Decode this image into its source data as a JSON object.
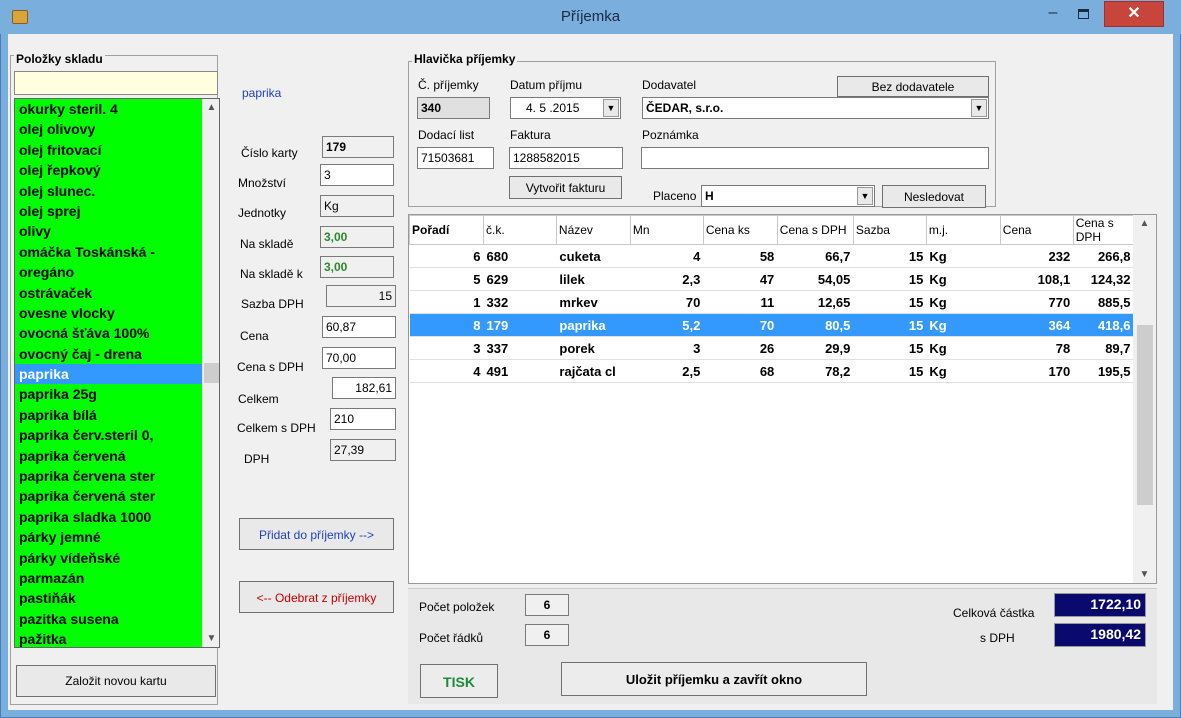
{
  "window": {
    "title": "Příjemka",
    "min": "–",
    "close": "✕"
  },
  "left": {
    "title": "Položky skladu",
    "search_value": "",
    "items": [
      "okurky steril. 4",
      "olej  olivovy",
      "olej fritovací",
      "olej řepkový",
      "olej slunec.",
      "olej sprej",
      "olivy",
      "omáčka Toskánská -",
      "oregáno",
      "ostrávaček",
      "ovesne vlocky",
      "ovocná šťáva 100%",
      "ovocný čaj - drena",
      "paprika",
      "paprika 25g",
      "paprika bílá",
      "paprika červ.steril 0,",
      "paprika červená",
      "paprika červena ster",
      "paprika červená ster",
      "paprika sladka 1000",
      "párky jemné",
      "párky vídeňské",
      "parmazán",
      "pastiňák",
      "pazitka susena",
      "pažitka"
    ],
    "selected_index": 13,
    "new_card_label": "Založit novou kartu"
  },
  "detail": {
    "name": "paprika",
    "labels": {
      "card_no": "Číslo karty",
      "qty": "Množství",
      "unit": "Jednotky",
      "stock": "Na skladě",
      "stock_k": "Na skladě k",
      "vat_rate": "Sazba DPH",
      "price": "Cena",
      "price_vat": "Cena s DPH",
      "total": "Celkem",
      "total_vat": "Celkem s DPH",
      "vat": "DPH"
    },
    "values": {
      "card_no": "179",
      "qty": "3",
      "unit": "Kg",
      "stock": "3,00",
      "stock_k": "3,00",
      "vat_rate": "15",
      "price": "60,87",
      "price_vat": "70,00",
      "total": "182,61",
      "total_vat": "210",
      "vat": "27,39"
    },
    "add_label": "Přidat do příjemky -->",
    "remove_label": "<-- Odebrat z příjemky"
  },
  "header": {
    "title": "Hlavička příjemky",
    "receipt_no_label": "Č. příjemky",
    "receipt_no": "340",
    "date_label": "Datum příjmu",
    "date": "4. 5 .2015",
    "supplier_label": "Dodavatel",
    "supplier": "ČEDAR, s.r.o.",
    "no_supplier_label": "Bez dodavatele",
    "delivery_label": "Dodací list",
    "delivery": "71503681",
    "invoice_label": "Faktura",
    "invoice": "1288582015",
    "note_label": "Poznámka",
    "note": "",
    "create_invoice_label": "Vytvořit fakturu",
    "paid_label": "Placeno",
    "paid": "H",
    "not_follow_label": "Nesledovat"
  },
  "table": {
    "columns": [
      "Pořadí",
      "č.k.",
      "Název",
      "Mn",
      "Cena ks",
      "Cena s DPH",
      "Sazba",
      "m.j.",
      "Cena",
      "Cena s DPH"
    ],
    "rows": [
      [
        "6",
        "680",
        "cuketa",
        "4",
        "58",
        "66,7",
        "15",
        "Kg",
        "232",
        "266,8"
      ],
      [
        "5",
        "629",
        "lilek",
        "2,3",
        "47",
        "54,05",
        "15",
        "Kg",
        "108,1",
        "124,32"
      ],
      [
        "1",
        "332",
        "mrkev",
        "70",
        "11",
        "12,65",
        "15",
        "Kg",
        "770",
        "885,5"
      ],
      [
        "8",
        "179",
        "paprika",
        "5,2",
        "70",
        "80,5",
        "15",
        "Kg",
        "364",
        "418,6"
      ],
      [
        "3",
        "337",
        "porek",
        "3",
        "26",
        "29,9",
        "15",
        "Kg",
        "78",
        "89,7"
      ],
      [
        "4",
        "491",
        "rajčata cl",
        "2,5",
        "68",
        "78,2",
        "15",
        "Kg",
        "170",
        "195,5"
      ]
    ],
    "selected_row": 3
  },
  "footer": {
    "item_count_label": "Počet položek",
    "item_count": "6",
    "row_count_label": "Počet řádků",
    "row_count": "6",
    "total_label": "Celková částka",
    "total": "1722,10",
    "total_vat_label": "s DPH",
    "total_vat": "1980,42",
    "print_label": "TISK",
    "save_label": "Uložit příjemku a zavřít okno"
  }
}
